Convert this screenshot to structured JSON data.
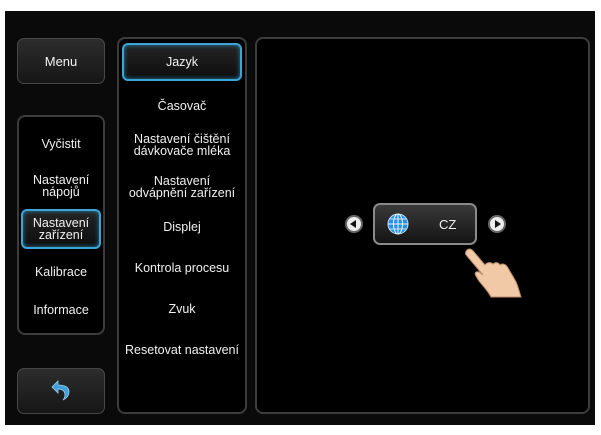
{
  "menu": {
    "label": "Menu"
  },
  "nav": {
    "items": [
      {
        "label": "Vyčistit"
      },
      {
        "label": "Nastavení nápojů"
      },
      {
        "label": "Nastavení zařízení"
      },
      {
        "label": "Kalibrace"
      },
      {
        "label": "Informace"
      }
    ],
    "back_icon": "back-arrow-icon"
  },
  "submenu": {
    "items": [
      {
        "label": "Jazyk"
      },
      {
        "label": "Časovač"
      },
      {
        "label": "Nastavení čištění dávkovače mléka"
      },
      {
        "label": "Nastavení odvápnění zařízení"
      },
      {
        "label": "Displej"
      },
      {
        "label": "Kontrola procesu"
      },
      {
        "label": "Zvuk"
      },
      {
        "label": "Resetovat nastavení"
      }
    ]
  },
  "language": {
    "code": "CZ",
    "icon": "globe-icon",
    "prev_icon": "arrow-left-icon",
    "next_icon": "arrow-right-icon"
  },
  "colors": {
    "accent": "#3aa6d6",
    "background": "#000000",
    "text": "#f0f0f0"
  }
}
